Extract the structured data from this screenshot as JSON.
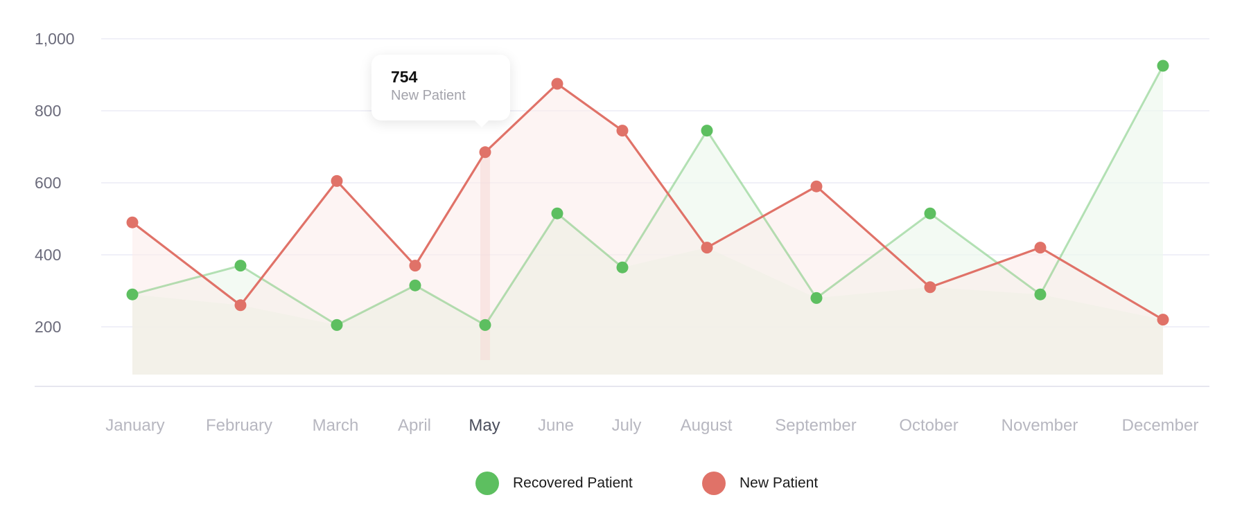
{
  "colors": {
    "recovered": "#5dbf60",
    "new": "#e07268",
    "grid": "#ebebf5",
    "axis": "#e6e6ef"
  },
  "tooltip": {
    "value": "754",
    "label": "New Patient"
  },
  "legend": [
    {
      "label": "Recovered Patient",
      "color": "#5dbf60"
    },
    {
      "label": "New Patient",
      "color": "#e07268"
    }
  ],
  "chart_data": {
    "type": "line",
    "title": "",
    "xlabel": "",
    "ylabel": "",
    "categories": [
      "January",
      "February",
      "March",
      "April",
      "May",
      "June",
      "July",
      "August",
      "September",
      "October",
      "November",
      "December"
    ],
    "highlighted_category": "May",
    "y_ticks": [
      "200",
      "400",
      "600",
      "800",
      "1,000"
    ],
    "ylim": [
      70,
      1000
    ],
    "grid": true,
    "area_fill": true,
    "legend_position": "bottom-center",
    "series": [
      {
        "name": "Recovered Patient",
        "color": "#5dbf60",
        "values": [
          290,
          370,
          205,
          315,
          205,
          515,
          365,
          745,
          280,
          515,
          290,
          925
        ]
      },
      {
        "name": "New Patient",
        "color": "#e07268",
        "values": [
          490,
          260,
          605,
          370,
          685,
          875,
          745,
          420,
          590,
          310,
          420,
          220
        ]
      }
    ]
  }
}
